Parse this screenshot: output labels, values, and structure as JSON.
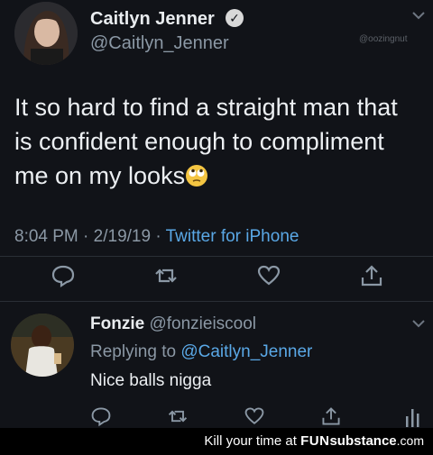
{
  "tweet": {
    "author_name": "Caitlyn Jenner",
    "author_handle": "@Caitlyn_Jenner",
    "watermark": "@oozingnut",
    "text_line1": "It so hard to find a straight man that",
    "text_line2": "is confident enough to compliment",
    "text_line3": "me on my looks",
    "time": "8:04 PM",
    "date": "2/19/19",
    "separator": "·",
    "source": "Twitter for iPhone",
    "icons": [
      "reply-icon",
      "retweet-icon",
      "like-icon",
      "share-icon"
    ],
    "emoji": "face-with-rolling-eyes"
  },
  "reply": {
    "author_name": "Fonzie",
    "author_handle": "@fonzieiscool",
    "replying_to_label": "Replying to",
    "replying_to_handle": "@Caitlyn_Jenner",
    "text": "Nice balls nigga",
    "icons": [
      "reply-icon",
      "retweet-icon",
      "like-icon",
      "share-icon",
      "analytics-icon"
    ]
  },
  "footer": {
    "text_prefix": "Kill your time at",
    "brand_part1": "FUN",
    "brand_part2": "substance",
    "brand_part3": ".com"
  },
  "colors": {
    "background": "#111318",
    "link": "#5aa8e6",
    "muted": "#8b98a5"
  }
}
